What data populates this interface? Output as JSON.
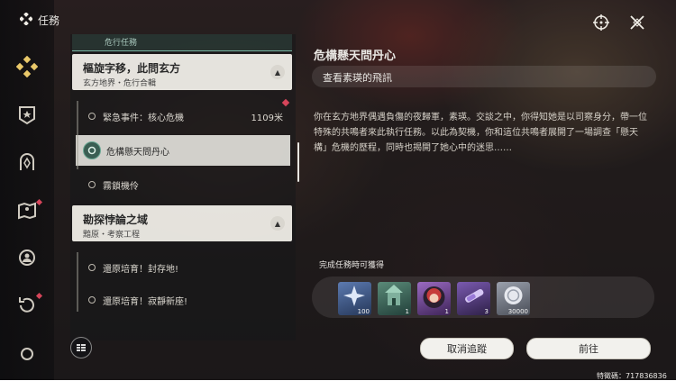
{
  "header": {
    "title": "任務"
  },
  "quest_list": {
    "partial_top_label": "危行任務",
    "groups": [
      {
        "title": "樞旋字移，此問玄方",
        "subtitle": "玄方地界・危行合輯",
        "items": [
          {
            "label": "緊急事件：核心危機",
            "distance": "1109米"
          },
          {
            "label": "危構懸天問丹心",
            "selected": true
          },
          {
            "label": "霧鎖機伶"
          }
        ]
      },
      {
        "title": "勘探悖論之域",
        "subtitle": "黯原・考察工程",
        "items": [
          {
            "label": "還原培育！封存地!"
          },
          {
            "label": "還原培育！寂靜新座!"
          }
        ]
      }
    ]
  },
  "detail": {
    "title": "危構懸天問丹心",
    "subtitle": "查看素瑛的飛訊",
    "description": "你在玄方地界偶遇負傷的夜歸軍，素瑛。交談之中，你得知她是以司察身分，帶一位特殊的共鳴者來此執行任務。以此為契機，你和這位共鳴者展開了一場調查「懸天構」危機的歷程，同時也揭開了她心中的迷思……"
  },
  "rewards": {
    "label": "完成任務時可獲得",
    "items": [
      {
        "icon": "star-shard-icon",
        "count": "100",
        "color": "#3d5a8a"
      },
      {
        "icon": "tower-icon",
        "count": "1",
        "color": "#3a6a5a"
      },
      {
        "icon": "character-portrait-icon",
        "count": "1",
        "color": "#7a4aa0"
      },
      {
        "icon": "crystal-tube-icon",
        "count": "3",
        "color": "#5b3f8a"
      },
      {
        "icon": "shell-coin-icon",
        "count": "30000",
        "color": "#6a6e78"
      }
    ]
  },
  "buttons": {
    "cancel_track": "取消追蹤",
    "go": "前往"
  },
  "uid": "特徵碼：717836836",
  "colors": {
    "accent_red": "#d6455a",
    "panel_light": "#f4f2ec"
  }
}
